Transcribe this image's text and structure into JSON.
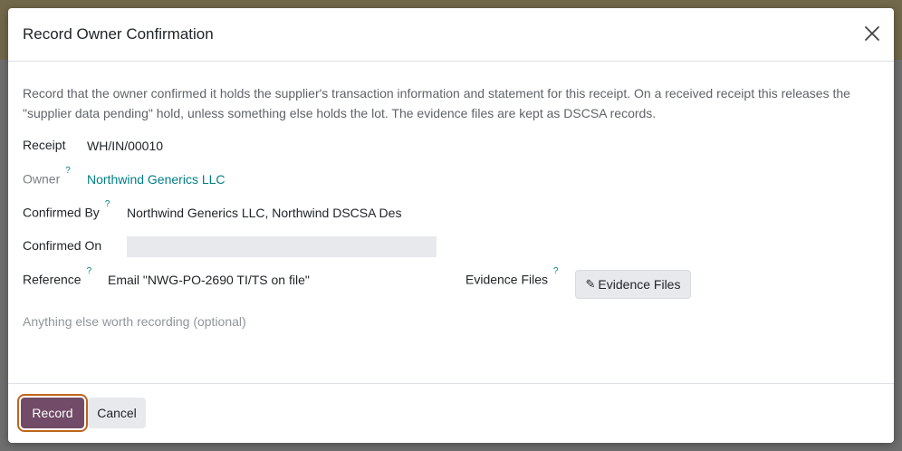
{
  "dialog": {
    "title": "Record Owner Confirmation",
    "intro": "Record that the owner confirmed it holds the supplier's transaction information and statement for this receipt. On a received receipt this releases the \"supplier data pending\" hold, unless something else holds the lot. The evidence files are kept as DSCSA records.",
    "help_mark": "?",
    "fields": {
      "receipt": {
        "label": "Receipt",
        "value": "WH/IN/00010"
      },
      "owner": {
        "label": "Owner",
        "value": "Northwind Generics LLC"
      },
      "confirmed_by": {
        "label": "Confirmed By",
        "value": "Northwind Generics LLC, Northwind DSCSA Des"
      },
      "confirmed_on": {
        "label": "Confirmed On",
        "value": ""
      },
      "reference": {
        "label": "Reference",
        "value": "Email \"NWG-PO-2690 TI/TS on file\""
      },
      "evidence_files": {
        "label": "Evidence Files",
        "button_label": "Evidence Files",
        "button_icon": "paperclip-icon"
      }
    },
    "notes_placeholder": "Anything else worth recording (optional)",
    "footer": {
      "record_label": "Record",
      "cancel_label": "Cancel"
    }
  },
  "colors": {
    "primary": "#714b67",
    "link": "#017e84",
    "focus_ring": "#c0651c",
    "secondary_bg": "#e7e9ed"
  }
}
